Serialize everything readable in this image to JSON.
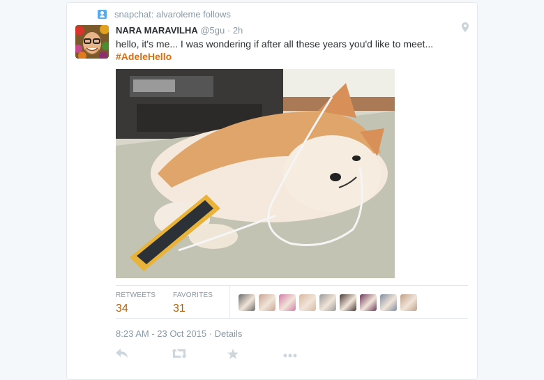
{
  "context": {
    "text": "snapchat: alvaroleme follows"
  },
  "tweet": {
    "fullname": "NARA MARAVILHA",
    "screen_name": "@5gu",
    "separator": "·",
    "time": "2h",
    "text": "hello, it's me... I was wondering if after all these years you'd like to meet...",
    "hashtag": "#AdeleHello"
  },
  "stats": {
    "retweets_label": "RETWEETS",
    "retweets": "34",
    "favorites_label": "FAVORITES",
    "favorites": "31"
  },
  "favoriters": [
    "#6b6b6b",
    "#c9a493",
    "#d27fa7",
    "#d9b9a1",
    "#9a9a9a",
    "#4a3a35",
    "#6d3a5b",
    "#7d8f9e",
    "#bfa088"
  ],
  "meta": {
    "timestamp": "8:23 AM - 23 Oct 2015",
    "dot": "·",
    "details": "Details"
  },
  "actions": {
    "reply": "reply-icon",
    "retweet": "retweet-icon",
    "favorite": "star-icon",
    "more": "more-icon"
  },
  "colors": {
    "accent": "#b45f06",
    "hashtag": "#e46c06",
    "muted": "#8899a6",
    "icon": "#55acee"
  }
}
